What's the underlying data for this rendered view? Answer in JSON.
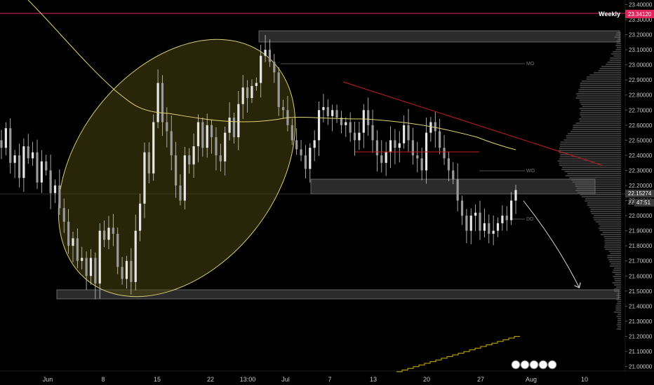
{
  "chart_data": {
    "type": "candlestick",
    "y_axis": {
      "ticks": [
        "23.40000",
        "23.30000",
        "23.20000",
        "23.10000",
        "23.00000",
        "22.90000",
        "22.80000",
        "22.70000",
        "22.60000",
        "22.50000",
        "22.40000",
        "22.30000",
        "22.20000",
        "22.10000",
        "22.00000",
        "21.90000",
        "21.80000",
        "21.70000",
        "21.60000",
        "21.50000",
        "21.40000",
        "21.30000",
        "21.20000",
        "21.10000",
        "21.00000"
      ],
      "range": [
        20.97,
        23.43
      ]
    },
    "x_axis": {
      "ticks": [
        "Jun",
        "8",
        "15",
        "22",
        "13:00",
        "Jul",
        "7",
        "13",
        "20",
        "27",
        "Aug",
        "10"
      ]
    },
    "weekly_level": {
      "label": "Weekly",
      "value": "23.34120",
      "price": 23.3412
    },
    "current_price": {
      "value": "22.15274",
      "countdown": "47:51",
      "partial": "22."
    },
    "level_labels": [
      "MO",
      "WO",
      "DO"
    ],
    "candles_close": [
      22.45,
      22.58,
      22.35,
      22.4,
      22.25,
      22.46,
      22.38,
      22.42,
      22.22,
      22.36,
      22.3,
      22.15,
      22.2,
      22.05,
      21.96,
      21.8,
      21.85,
      21.7,
      21.72,
      21.6,
      21.72,
      21.55,
      21.9,
      21.84,
      21.92,
      21.88,
      21.66,
      21.58,
      21.7,
      21.56,
      21.9,
      22.08,
      22.42,
      22.28,
      22.62,
      22.88,
      22.62,
      22.56,
      22.4,
      22.2,
      22.1,
      22.4,
      22.34,
      22.46,
      22.62,
      22.45,
      22.6,
      22.52,
      22.4,
      22.36,
      22.55,
      22.65,
      22.52,
      22.74,
      22.85,
      22.78,
      22.86,
      22.88,
      23.06,
      23.1,
      23.02,
      22.95,
      22.72,
      22.7,
      22.6,
      22.5,
      22.44,
      22.4,
      22.31,
      22.45,
      22.5,
      22.7,
      22.72,
      22.66,
      22.7,
      22.65,
      22.6,
      22.62,
      22.55,
      22.5,
      22.55,
      22.7,
      22.6,
      22.5,
      22.4,
      22.35,
      22.42,
      22.5,
      22.45,
      22.48,
      22.6,
      22.5,
      22.4,
      22.38,
      22.3,
      22.55,
      22.62,
      22.56,
      22.45,
      22.38,
      22.3,
      22.24,
      22.1,
      22.0,
      21.9,
      22.0,
      22.02,
      21.9,
      21.95,
      21.88,
      21.9,
      21.95,
      22.0,
      21.97,
      22.1,
      22.17
    ]
  },
  "colors": {
    "background": "#000000",
    "candle": "#d9d9d9",
    "moving_average": "#e2d373",
    "weekly_line": "#e0245e",
    "trendline": "#c81e1e",
    "zone_fill": "#2a2a2a",
    "ellipse_fill": "#4a4410"
  }
}
